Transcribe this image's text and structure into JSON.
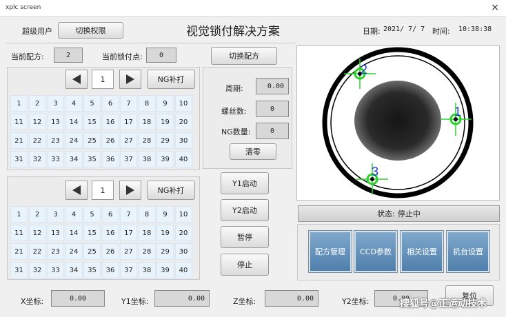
{
  "window": {
    "title": "xplc screen",
    "close": "×"
  },
  "header": {
    "user": "超级用户",
    "switch_permission": "切换权限",
    "title": "视觉锁付解决方案",
    "date_label": "日期:",
    "date": "2021/ 7/ 7",
    "time_label": "时间:",
    "time": "10:38:38"
  },
  "recipe": {
    "current_label": "当前配方:",
    "current_value": "2",
    "point_label": "当前锁付点:",
    "point_value": "0",
    "switch_button": "切换配方"
  },
  "panel1": {
    "page": "1",
    "ng_button": "NG补打"
  },
  "panel2": {
    "page": "1",
    "ng_button": "NG补打"
  },
  "grid": [
    "1",
    "2",
    "3",
    "4",
    "5",
    "6",
    "7",
    "8",
    "9",
    "10",
    "11",
    "12",
    "13",
    "14",
    "15",
    "16",
    "17",
    "18",
    "19",
    "20",
    "21",
    "22",
    "23",
    "24",
    "25",
    "26",
    "27",
    "28",
    "29",
    "30",
    "31",
    "32",
    "33",
    "34",
    "35",
    "36",
    "37",
    "38",
    "39",
    "40"
  ],
  "stats": {
    "cycle_label": "周期:",
    "cycle_value": "0.00",
    "screws_label": "螺丝数:",
    "screws_value": "0",
    "ng_label": "NG数量:",
    "ng_value": "0",
    "clear_button": "清零"
  },
  "controls": {
    "y1_start": "Y1启动",
    "y2_start": "Y2启动",
    "pause": "暂停",
    "stop": "停止"
  },
  "camera": {
    "markers": [
      "1",
      "2",
      "3"
    ]
  },
  "status": {
    "label": "状态:",
    "value": "停止中"
  },
  "menu": {
    "recipe_mgmt": "配方管理",
    "ccd_params": "CCD参数",
    "related_settings": "相关设置",
    "machine_settings": "机台设置"
  },
  "coords": {
    "x_label": "X坐标:",
    "x_value": "0.00",
    "y1_label": "Y1坐标:",
    "y1_value": "0.00",
    "z_label": "Z坐标:",
    "z_value": "0.00",
    "y2_label": "Y2坐标:",
    "y2_value": "0.00",
    "reset_button": "复位"
  },
  "watermark": "搜狐号@正运动技术"
}
